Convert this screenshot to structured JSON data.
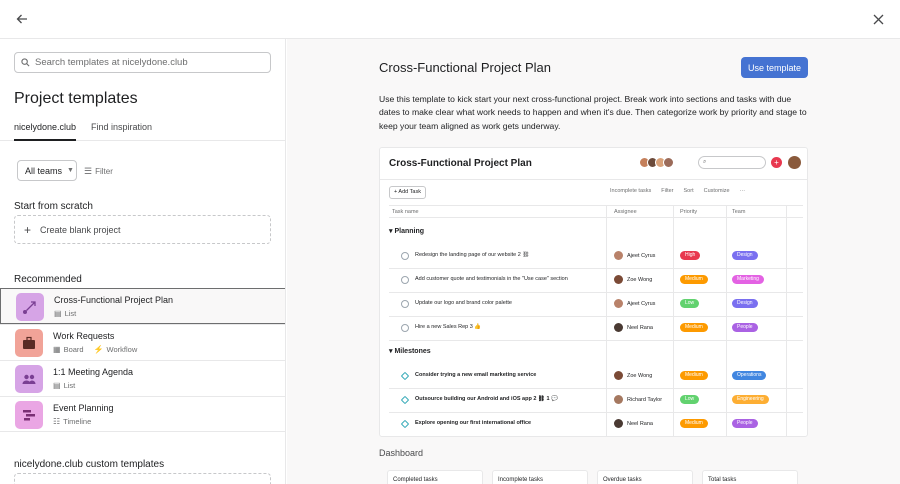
{
  "topbar": {
    "back_icon": "arrow-left-icon",
    "close_icon": "close-icon"
  },
  "left": {
    "search_placeholder": "Search templates at nicelydone.club",
    "title": "Project templates",
    "tabs": [
      {
        "label": "nicelydone.club"
      },
      {
        "label": "Find inspiration"
      }
    ],
    "teams_select": "All teams",
    "filter_label": "Filter",
    "scratch_heading": "Start from scratch",
    "blank_label": "Create blank project",
    "recommended_heading": "Recommended",
    "templates": [
      {
        "name": "Cross-Functional Project Plan",
        "meta": [
          "List"
        ],
        "color": "#c28bd6"
      },
      {
        "name": "Work Requests",
        "meta": [
          "Board",
          "Workflow"
        ],
        "color": "#e67d6f"
      },
      {
        "name": "1:1 Meeting Agenda",
        "meta": [
          "List"
        ],
        "color": "#c28bd6"
      },
      {
        "name": "Event Planning",
        "meta": [
          "Timeline"
        ],
        "color": "#d98ad3"
      }
    ],
    "custom_heading": "nicelydone.club custom templates"
  },
  "right": {
    "title": "Cross-Functional Project Plan",
    "use_button": "Use template",
    "description": "Use this template to kick start your next cross-functional project. Break work into sections and tasks with due dates to make clear what work needs to happen and when it's due. Then categorize work by priority and stage to keep your team aligned as work gets underway.",
    "preview": {
      "title": "Cross-Functional Project Plan",
      "add_task": "+ Add Task",
      "tools": [
        "Incomplete tasks",
        "Filter",
        "Sort",
        "Customize",
        "···"
      ],
      "columns": {
        "task": "Task name",
        "assignee": "Assignee",
        "priority": "Priority",
        "team": "Team"
      },
      "sections": [
        {
          "name": "Planning",
          "rows": [
            {
              "task": "Redesign the landing page of our website",
              "extra": "2 ⛓",
              "assignee": "Ajeet Cyrus",
              "priority": "High",
              "team": "Design"
            },
            {
              "task": "Add customer quote and testimonials in the \"Use case\" section",
              "extra": "",
              "assignee": "Zoe Wong",
              "priority": "Medium",
              "team": "Marketing"
            },
            {
              "task": "Update our logo and brand color palette",
              "extra": "",
              "assignee": "Ajeet Cyrus",
              "priority": "Low",
              "team": "Design"
            },
            {
              "task": "Hire a new Sales Rep",
              "extra": "3 👍",
              "assignee": "Neel Rana",
              "priority": "Medium",
              "team": "People"
            }
          ]
        },
        {
          "name": "Milestones",
          "rows": [
            {
              "task": "Consider trying a new email marketing service",
              "extra": "",
              "assignee": "Zoe Wong",
              "priority": "Medium",
              "team": "Operations"
            },
            {
              "task": "Outsource building our Android and iOS app",
              "extra": "2 ⛓   1 💬",
              "assignee": "Richard Taylor",
              "priority": "Low",
              "team": "Engineering"
            },
            {
              "task": "Explore opening our first international office",
              "extra": "",
              "assignee": "Neel Rana",
              "priority": "Medium",
              "team": "People"
            }
          ]
        }
      ],
      "colors": {
        "High": "#e8384f",
        "Medium": "#fd9a00",
        "Low": "#62d26f",
        "Design": "#7a6ff0",
        "Marketing": "#e362e3",
        "People": "#aa62e3",
        "Operations": "#4186e0",
        "Engineering": "#fdae33"
      }
    },
    "dashboard_label": "Dashboard",
    "dashboard_cards": [
      "Completed tasks",
      "Incomplete tasks",
      "Overdue tasks",
      "Total tasks"
    ]
  }
}
